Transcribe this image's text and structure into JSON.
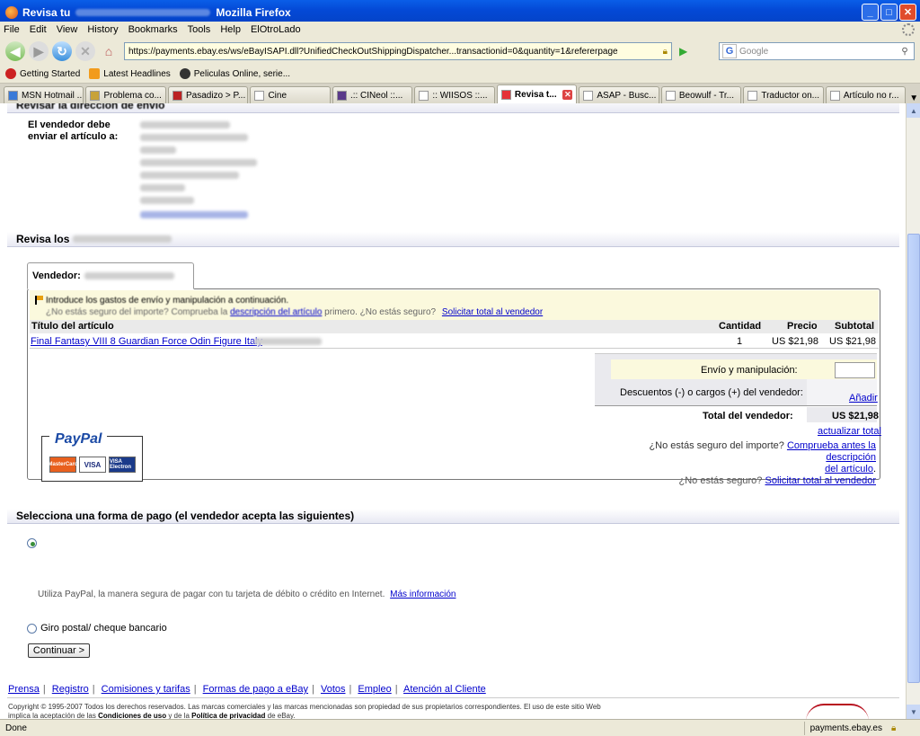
{
  "window": {
    "title_start": "Revisa tu",
    "title_end": "Mozilla Firefox",
    "minimize": "_",
    "maximize": "□",
    "close": "✕"
  },
  "menu": [
    "File",
    "Edit",
    "View",
    "History",
    "Bookmarks",
    "Tools",
    "Help",
    "ElOtroLado"
  ],
  "nav": {
    "url": "https://payments.ebay.es/ws/eBayISAPI.dll?UnifiedCheckOutShippingDispatcher...transactionid=0&quantity=1&refererpage",
    "search_placeholder": "Google",
    "google_label": "G"
  },
  "bookmarks": [
    "Getting Started",
    "Latest Headlines",
    "Peliculas Online, serie..."
  ],
  "tabs": [
    {
      "label": "MSN Hotmail ...",
      "active": false
    },
    {
      "label": "Problema co...",
      "active": false
    },
    {
      "label": "Pasadizo > P...",
      "active": false
    },
    {
      "label": "Cine",
      "active": false
    },
    {
      "label": ".:: CINeol ::...",
      "active": false
    },
    {
      "label": ":: WIISOS ::...",
      "active": false
    },
    {
      "label": "Revisa t...",
      "active": true
    },
    {
      "label": "ASAP - Busc...",
      "active": false
    },
    {
      "label": "Beowulf - Tr...",
      "active": false
    },
    {
      "label": "Traductor on...",
      "active": false
    },
    {
      "label": "Artículo no r...",
      "active": false
    }
  ],
  "page": {
    "address_section_title": "Revisar la dirección de envío",
    "ship_label_1": "El vendedor debe",
    "ship_label_2": "enviar el artículo a:",
    "details_section_prefix": "Revisa los",
    "seller_label": "Vendedor:",
    "notice_line1": "Introduce los gastos de envío y manipulación a continuación.",
    "notice_line2_prefix": "¿No estás seguro del importe? Comprueba la",
    "notice_link1": "descripción del artículo",
    "notice_line2_mid": "primero. ¿No estás seguro?",
    "notice_link2": "Solicitar total al vendedor",
    "table": {
      "col_title": "Título del artículo",
      "col_qty": "Cantidad",
      "col_price": "Precio",
      "col_subtotal": "Subtotal",
      "item_title": "Final Fantasy VIII 8 Guardian Force Odin Figure Italy",
      "item_qty": "1",
      "item_price": "US $21,98",
      "item_subtotal": "US $21,98"
    },
    "totals": {
      "shipping_label": "Envío y manipulación:",
      "discounts_label": "Descuentos (-) o cargos (+) del vendedor:",
      "add_link": "Añadir",
      "seller_total_label": "Total del vendedor:",
      "seller_total_value": "US $21,98",
      "update_total": "actualizar total",
      "unsure_amount": "¿No estás seguro del importe?",
      "check_desc_link_1": "Comprueba antes la descripción",
      "check_desc_link_2": "del artículo",
      "unsure": "¿No estás seguro?",
      "request_total_link": "Solicitar total al vendedor"
    },
    "payment_section_title": "Selecciona una forma de pago (el vendedor acepta las siguientes)",
    "paypal_logo": "PayPal",
    "card_mastercard": "MasterCard",
    "card_visa": "VISA",
    "card_electron": "VISA Electron",
    "paypal_desc": "Utiliza PayPal, la manera segura de pagar con tu tarjeta de débito o crédito en Internet.",
    "more_info": "Más información",
    "giro_label": "Giro postal/ cheque bancario",
    "continue_button": "Continuar >"
  },
  "footer": {
    "links": [
      "Prensa",
      "Registro",
      "Comisiones y tarifas",
      "Formas de pago a eBay",
      "Votos",
      "Empleo",
      "Atención al Cliente"
    ],
    "copyright_1": "Copyright © 1995-2007 Todos los derechos reservados. Las marcas comerciales y las marcas mencionadas son propiedad de sus propietarios correspondientes. El uso de este sitio Web",
    "copyright_2_prefix": "implica la aceptación de las",
    "terms_link": "Condiciones de uso",
    "copyright_2_mid": "y de la",
    "privacy_link": "Política de privacidad",
    "copyright_2_end": "de eBay."
  },
  "status": {
    "text": "Done",
    "host": "payments.ebay.es"
  },
  "colors": {
    "titlebar": "#0449d6",
    "link": "#0000cc",
    "notice_bg": "#fbf9dd"
  }
}
